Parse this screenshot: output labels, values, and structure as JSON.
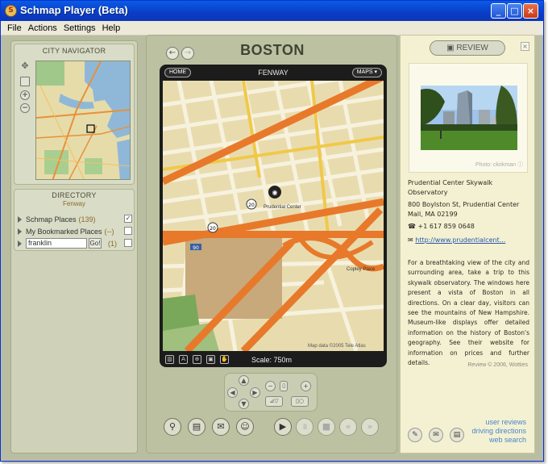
{
  "window": {
    "title": "Schmap Player (Beta)",
    "app_icon": "S",
    "controls": {
      "minimize": "_",
      "maximize": "□",
      "close": "×"
    }
  },
  "menu": [
    "File",
    "Actions",
    "Settings",
    "Help"
  ],
  "left": {
    "navigator_title": "CITY NAVIGATOR",
    "directory_title": "DIRECTORY",
    "directory_sub": "Fenway",
    "rows": [
      {
        "label": "Schmap Places",
        "count": "(139)",
        "checked": "✓"
      },
      {
        "label": "My Bookmarked Places",
        "count": "(--)",
        "checked": ""
      }
    ],
    "search": {
      "value": "franklin",
      "go": "Go!",
      "count": "(1)"
    }
  },
  "center": {
    "city": "BOSTON",
    "area": "FENWAY",
    "home_label": "HOME",
    "maps_label": "MAPS ▾",
    "back": "←",
    "forward": "→",
    "scale": "Scale: 750m",
    "map_labels": {
      "poi": "Prudential Center",
      "copley": "Copley Place",
      "data": "Map data ©2005 Tele Atlas",
      "route20a": "20",
      "route20b": "20",
      "route90": "90"
    },
    "tools": [
      "▥",
      "A",
      "⊕",
      "▣",
      "✋"
    ],
    "dpad": {
      "up": "▲",
      "down": "▼",
      "left": "◀",
      "right": "▶",
      "zoom_out": "−",
      "zoom_in": "+",
      "slider": "▯",
      "tilt": "⊿▽",
      "view": "▯○"
    },
    "actions": [
      "⚲",
      "▤",
      "✉",
      "☺"
    ],
    "playback": [
      "▶",
      "॥",
      "■",
      "«",
      "»"
    ]
  },
  "right": {
    "review_label": "REVIEW",
    "close": "×",
    "photo_credit": "Photo: ckirkman",
    "place_name": "Prudential Center Skywalk Observatory",
    "address_line1": "800 Boylston St, Prudential Center",
    "address_line2": "Mall, MA 02199",
    "phone": "+1 617 859 0648",
    "url": "http://www.prudentialcent...",
    "description": "For a breathtaking view of the city and surrounding area, take a trip to this skywalk observatory. The windows here present a vista of Boston in all directions. On a clear day, visitors can see the mountains of New Hampshire. Museum-like displays offer detailed information on the history of Boston's geography. See their website for information on prices and further details.",
    "copyright": "Review © 2006, Wotties",
    "links": [
      "user reviews",
      "driving directions",
      "web search"
    ],
    "bottom_icons": [
      "✎",
      "✉",
      "▤"
    ]
  }
}
